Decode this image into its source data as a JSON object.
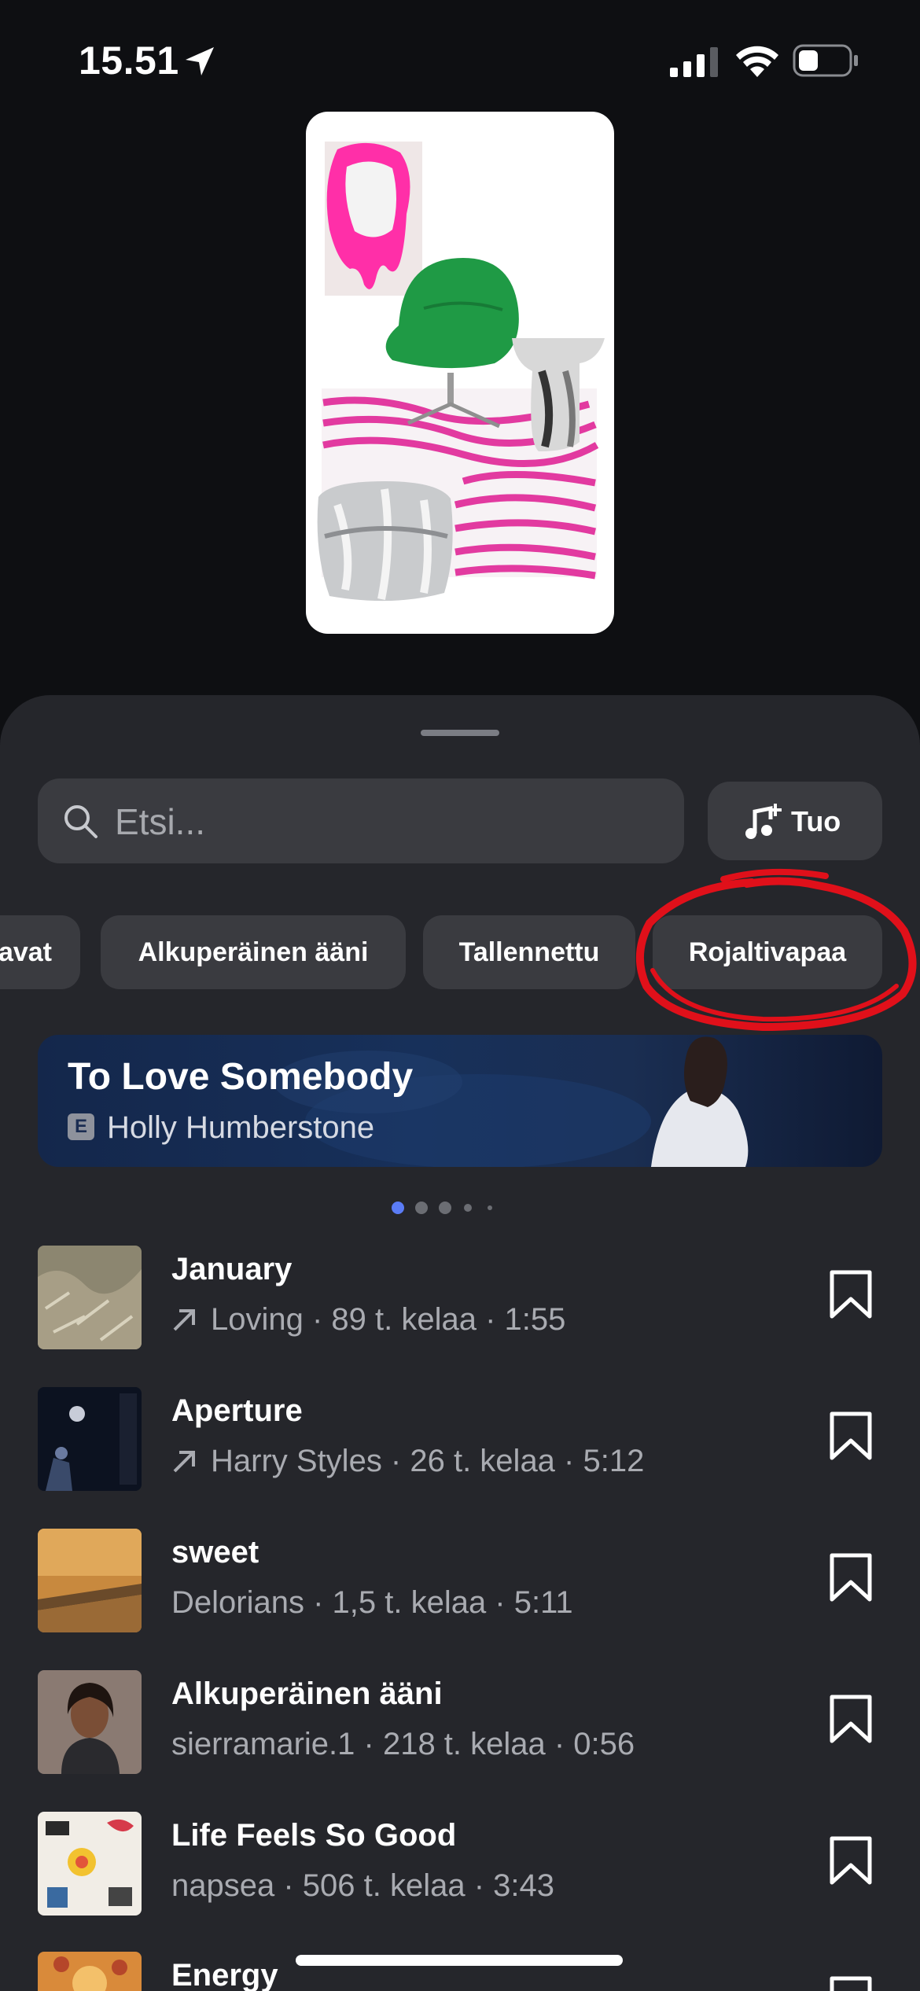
{
  "status_bar": {
    "time": "15.51"
  },
  "search": {
    "placeholder": "Etsi..."
  },
  "import_button": {
    "label": "Tuo"
  },
  "filter_chips": [
    {
      "label": "avat"
    },
    {
      "label": "Alkuperäinen ääni"
    },
    {
      "label": "Tallennettu"
    },
    {
      "label": "Rojaltivapaa"
    }
  ],
  "featured": {
    "title": "To Love Somebody",
    "explicit_badge": "E",
    "artist": "Holly Humberstone"
  },
  "pager": {
    "pages": 5,
    "active_index": 0
  },
  "tracks": [
    {
      "title": "January",
      "meta": "Loving · 89 t. kelaa · 1:55",
      "trending": true
    },
    {
      "title": "Aperture",
      "meta": "Harry Styles · 26 t. kelaa · 5:12",
      "trending": true
    },
    {
      "title": "sweet",
      "meta": "Delorians · 1,5 t. kelaa · 5:11",
      "trending": false
    },
    {
      "title": "Alkuperäinen ääni",
      "meta": "sierramarie.1 · 218 t. kelaa · 0:56",
      "trending": false
    },
    {
      "title": "Life Feels So Good",
      "meta": "napsea · 506 t. kelaa · 3:43",
      "trending": false
    },
    {
      "title": "Energy",
      "meta": "",
      "trending": false
    }
  ],
  "colors": {
    "background": "#0e0f12",
    "sheet": "#25262b",
    "control": "#3a3b40",
    "annotation": "#e0101a",
    "pager_active": "#5b7cf5"
  }
}
